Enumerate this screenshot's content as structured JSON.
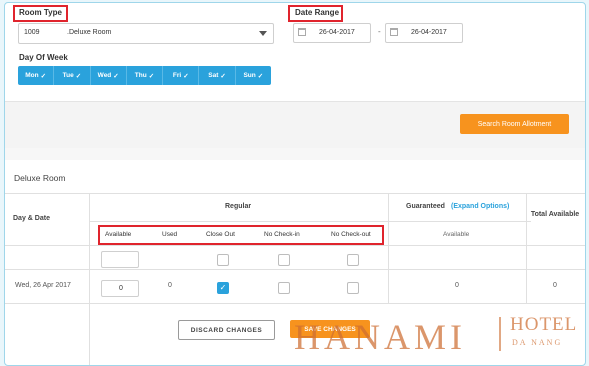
{
  "filters": {
    "room_type_label": "Room Type",
    "room_code": "1009",
    "room_name": ".Deluxe Room",
    "date_range_label": "Date Range",
    "date_from": "26-04-2017",
    "date_sep": "-",
    "date_to": "26-04-2017",
    "day_of_week_label": "Day Of Week",
    "days": [
      "Mon",
      "Tue",
      "Wed",
      "Thu",
      "Fri",
      "Sat",
      "Sun"
    ],
    "check_glyph": "✓",
    "search_button": "Search Room Allotment"
  },
  "table": {
    "section_title": "Deluxe Room",
    "col_day_date": "Day & Date",
    "col_regular": "Regular",
    "col_guaranteed": "Guaranteed",
    "expand_options": "(Expand Options)",
    "col_total_available": "Total Available",
    "regular_subcols": [
      "Available",
      "Used",
      "Close Out",
      "No Check-in",
      "No Check-out"
    ],
    "guaranteed_subcol": "Available",
    "row": {
      "date": "Wed, 26 Apr 2017",
      "available": "0",
      "used": "0",
      "close_out_checked": true,
      "no_checkin_checked": false,
      "no_checkout_checked": false,
      "guaranteed_available": "0",
      "total_available": "0"
    }
  },
  "actions": {
    "discard": "DISCARD CHANGES",
    "save": "SAVE CHANGES"
  },
  "watermark": {
    "brand": "HANAMI",
    "hotel": "HOTEL",
    "city": "DA NANG"
  },
  "colors": {
    "accent_blue": "#2aa2dc",
    "action_orange": "#f7931e",
    "highlight_red": "#e0242d"
  }
}
